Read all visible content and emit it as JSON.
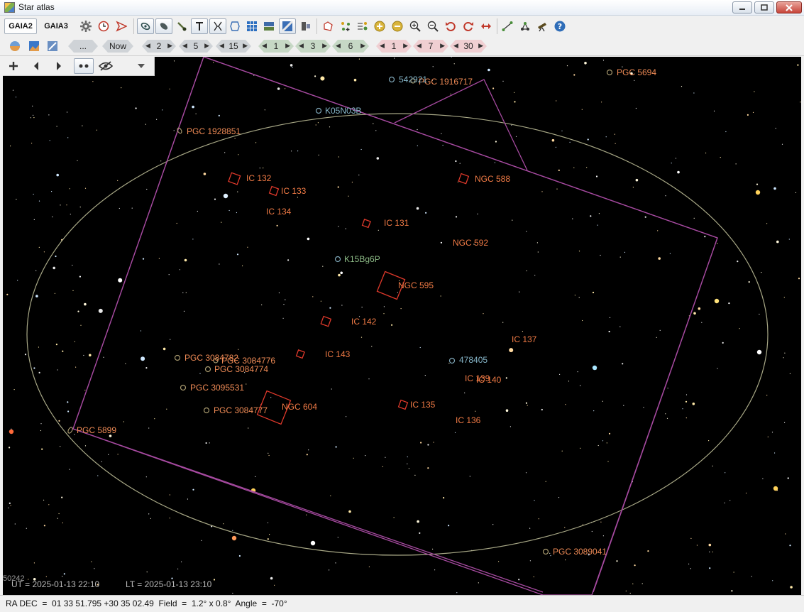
{
  "window": {
    "title": "Star atlas"
  },
  "toolbar1": {
    "catalog_buttons": [
      "GAIA2",
      "GAIA3"
    ]
  },
  "toolbar2": {
    "more_label": "...",
    "now_label": "Now",
    "steps_grey": [
      "2",
      "5",
      "15"
    ],
    "steps_green": [
      "1",
      "3",
      "6"
    ],
    "steps_pink": [
      "1",
      "7",
      "30"
    ]
  },
  "objects": {
    "ngc": [
      "NGC 588",
      "NGC 592",
      "NGC 595",
      "NGC 604"
    ],
    "ic": [
      "IC 132",
      "IC 133",
      "IC 134",
      "IC 131",
      "IC 142",
      "IC 143",
      "IC 137",
      "IC 139",
      "IC 140",
      "IC 135",
      "IC 136"
    ],
    "pgc": [
      "PGC 5694",
      "PGC 1916717",
      "PGC 1928851",
      "PGC 3084782",
      "PGC 3084776",
      "PGC 3084774",
      "PGC 3095531",
      "PGC 3084777",
      "PGC 5899",
      "PGC 3089041"
    ],
    "asteroids": [
      "542921",
      "K05N03B",
      "K15Bg6P",
      "478405"
    ],
    "edge_label": "50242"
  },
  "times": {
    "ut": "UT = 2025-01-13  22:10",
    "lt": "LT = 2025-01-13  23:10"
  },
  "status": {
    "text": "RA DEC  =  01 33 51.795 +30 35 02.49  Field  =  1.2° x 0.8°  Angle  =  -70°"
  },
  "colors": {
    "sky_background": "#000000",
    "frame": "#a64aa0",
    "ellipse": "#a8a886",
    "galaxy_box": "#e0392b"
  }
}
